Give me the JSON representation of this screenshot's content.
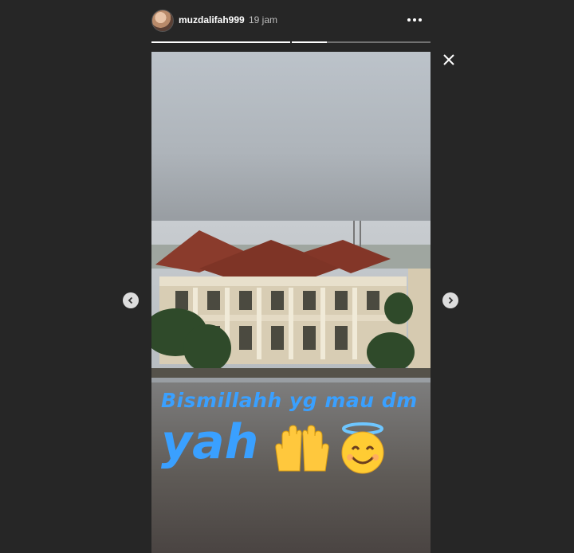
{
  "header": {
    "username": "muzdalifah999",
    "timestamp": "19 jam",
    "more_icon": "more-horizontal-icon"
  },
  "progress": {
    "segments": 2,
    "current_segment": 2,
    "current_fill": 0.25
  },
  "story": {
    "caption_line1": "Bismillahh yg mau dm",
    "caption_line2": "yah",
    "caption_color": "#3aa0ff",
    "emojis": [
      "raising-hands-emoji",
      "smiling-face-with-halo-emoji"
    ]
  },
  "controls": {
    "close_icon": "close-icon",
    "prev_icon": "chevron-left-icon",
    "next_icon": "chevron-right-icon"
  }
}
